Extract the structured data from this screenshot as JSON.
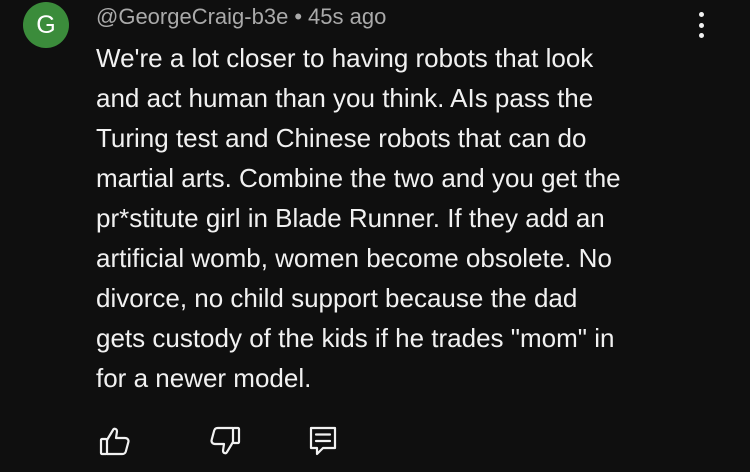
{
  "comment": {
    "avatar_letter": "G",
    "avatar_color": "#3b8c3b",
    "author": "@GeorgeCraig-b3e",
    "separator": "•",
    "timestamp": "45s ago",
    "text_lines": [
      "We're a lot closer to having robots that look",
      "and act human than you think. AIs pass the",
      "Turing test and Chinese robots that can do",
      "martial arts. Combine the two and you get the",
      "pr*stitute girl in Blade Runner. If they add an",
      "artificial womb, women become obsolete. No",
      "divorce, no child support because the dad",
      "gets custody of the kids if he trades \"mom\" in",
      "for a newer model."
    ]
  },
  "actions": {
    "like_icon": "thumbs-up-icon",
    "dislike_icon": "thumbs-down-icon",
    "reply_icon": "reply-comment-icon",
    "more_icon": "vertical-ellipsis-icon"
  },
  "theme": {
    "background": "#0f0f0f",
    "text": "#f1f1f1",
    "secondary_text": "#aaaaaa"
  }
}
